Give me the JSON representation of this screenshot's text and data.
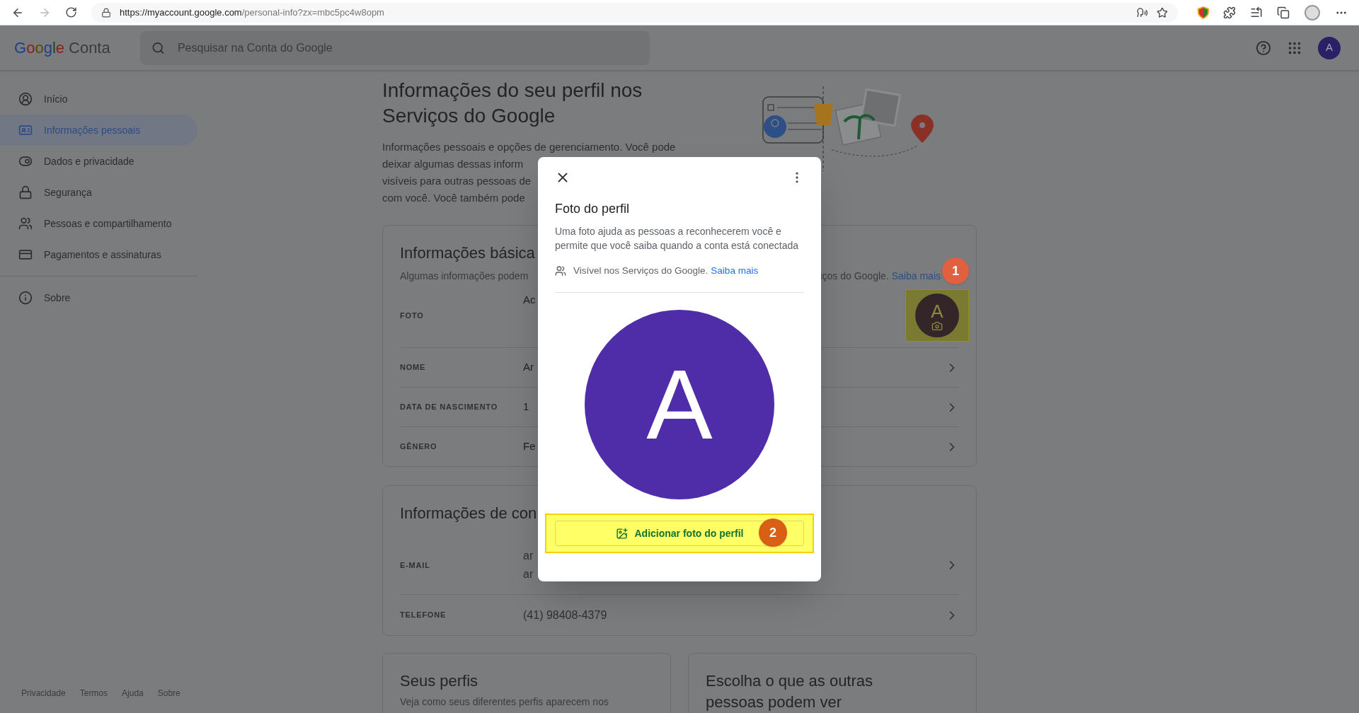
{
  "browser": {
    "url_host": "https://myaccount.google.com",
    "url_path": "/personal-info?zx=mbc5pc4w8opm",
    "forward_disabled": true
  },
  "header": {
    "logo": "Google",
    "product": "Conta",
    "search_placeholder": "Pesquisar na Conta do Google",
    "avatar_letter": "A"
  },
  "sidebar": {
    "items": [
      {
        "label": "Início",
        "kind": "user",
        "selected": false
      },
      {
        "label": "Informações pessoais",
        "kind": "idcard",
        "selected": true
      },
      {
        "label": "Dados e privacidade",
        "kind": "toggle",
        "selected": false
      },
      {
        "label": "Segurança",
        "kind": "lock",
        "selected": false
      },
      {
        "label": "Pessoas e compartilhamento",
        "kind": "people",
        "selected": false
      },
      {
        "label": "Pagamentos e assinaturas",
        "kind": "card",
        "selected": false
      }
    ],
    "secondary_items": [
      {
        "label": "Sobre",
        "kind": "info",
        "selected": false
      }
    ],
    "footer_links": [
      "Privacidade",
      "Termos",
      "Ajuda",
      "Sobre"
    ]
  },
  "page": {
    "title": "Informações do seu perfil nos Serviços do Google",
    "intro_lines": [
      "Informações pessoais e opções de gerenciamento. Você pode",
      "deixar algumas dessas inform",
      "visíveis para outras pessoas de",
      "com você. Você também pode"
    ]
  },
  "basic_info": {
    "title": "Informações básica",
    "subtitle_left": "Algumas informações podem",
    "subtitle_right": "iços do Google.",
    "link": "Saiba mais",
    "rows": [
      {
        "kind": "photo",
        "label": "FOTO",
        "value": "Ac",
        "avatar_letter": "A"
      },
      {
        "kind": "text",
        "label": "NOME",
        "value": "Ar"
      },
      {
        "kind": "text",
        "label": "DATA DE NASCIMENTO",
        "value": "1"
      },
      {
        "kind": "text",
        "label": "GÊNERO",
        "value": "Fe"
      }
    ]
  },
  "contact_info": {
    "title": "Informações de con",
    "rows": [
      {
        "label": "E-MAIL",
        "values": [
          "ar",
          "ar"
        ]
      },
      {
        "label": "TELEFONE",
        "values": [
          "(41) 98408-4379"
        ]
      }
    ]
  },
  "bottom_cards": [
    {
      "title": "Seus perfis",
      "text": "Veja como seus diferentes perfis aparecem nos"
    },
    {
      "title": "Escolha o que as outras pessoas podem ver"
    }
  ],
  "dialog": {
    "title": "Foto do perfil",
    "description": "Uma foto ajuda as pessoas a reconhecerem você e permite que você saiba quando a conta está conectada",
    "visibility_text": "Visível nos Serviços do Google.",
    "link": "Saiba mais",
    "avatar_letter": "A",
    "button": "Adicionar foto do perfil"
  },
  "annotations": [
    {
      "number": "1",
      "color": "#e0603f"
    },
    {
      "number": "2",
      "color": "#d95f14"
    }
  ]
}
